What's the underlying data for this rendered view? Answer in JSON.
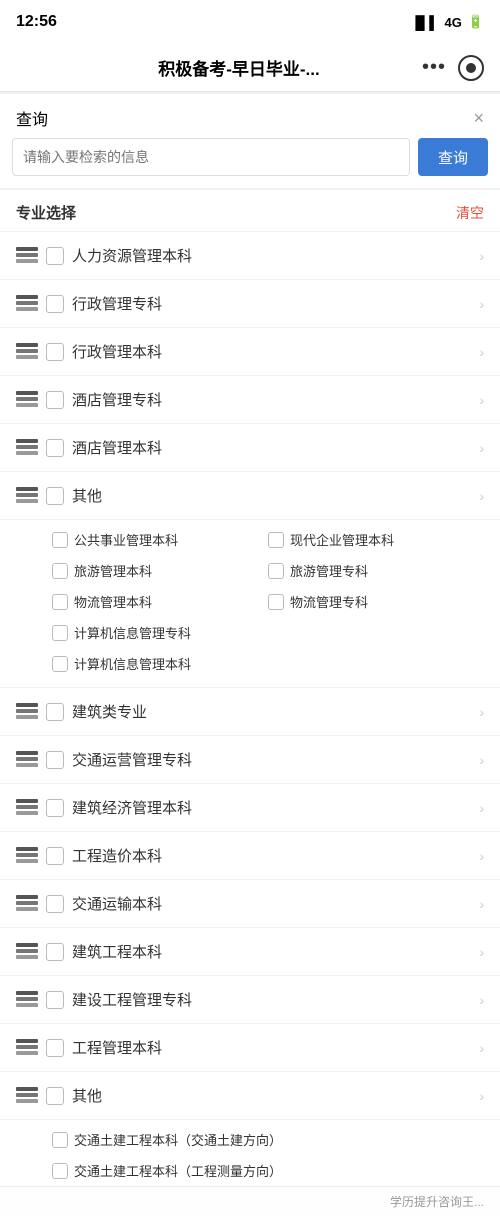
{
  "statusBar": {
    "time": "12:56",
    "signal": "4G",
    "icons": "◀"
  },
  "navBar": {
    "title": "积极备考-早日毕业-...",
    "dots": "•••"
  },
  "searchPanel": {
    "headerLabel": "查询",
    "closeIcon": "×",
    "inputPlaceholder": "请输入要检索的信息",
    "searchBtnLabel": "查询"
  },
  "majorSection": {
    "title": "专业选择",
    "clearLabel": "清空",
    "items": [
      {
        "id": 1,
        "label": "人力资源管理本科",
        "hasChevron": true,
        "expanded": false
      },
      {
        "id": 2,
        "label": "行政管理专科",
        "hasChevron": true,
        "expanded": false
      },
      {
        "id": 3,
        "label": "行政管理本科",
        "hasChevron": true,
        "expanded": false
      },
      {
        "id": 4,
        "label": "酒店管理专科",
        "hasChevron": true,
        "expanded": false
      },
      {
        "id": 5,
        "label": "酒店管理本科",
        "hasChevron": true,
        "expanded": false
      },
      {
        "id": 6,
        "label": "其他",
        "hasChevron": true,
        "expanded": true
      },
      {
        "id": 7,
        "label": "建筑类专业",
        "hasChevron": true,
        "expanded": false
      },
      {
        "id": 8,
        "label": "交通运营管理专科",
        "hasChevron": true,
        "expanded": false
      },
      {
        "id": 9,
        "label": "建筑经济管理本科",
        "hasChevron": true,
        "expanded": false
      },
      {
        "id": 10,
        "label": "工程造价本科",
        "hasChevron": true,
        "expanded": false
      },
      {
        "id": 11,
        "label": "交通运输本科",
        "hasChevron": true,
        "expanded": false
      },
      {
        "id": 12,
        "label": "建筑工程本科",
        "hasChevron": true,
        "expanded": false
      },
      {
        "id": 13,
        "label": "建设工程管理专科",
        "hasChevron": true,
        "expanded": false
      },
      {
        "id": 14,
        "label": "工程管理本科",
        "hasChevron": true,
        "expanded": false
      },
      {
        "id": 15,
        "label": "其他",
        "hasChevron": true,
        "expanded": false
      }
    ],
    "subItems": {
      "col1": [
        "公共事业管理本科",
        "旅游管理本科",
        "物流管理本科",
        "计算机信息管理专科",
        "计算机信息管理本科"
      ],
      "col2": [
        "现代企业管理本科",
        "旅游管理专科",
        "物流管理专科"
      ]
    },
    "bottomSubItems": {
      "col1": [
        "交通土建工程本科（交通土建方向）",
        "交通土建工程本科（工程测量方向）"
      ]
    }
  }
}
